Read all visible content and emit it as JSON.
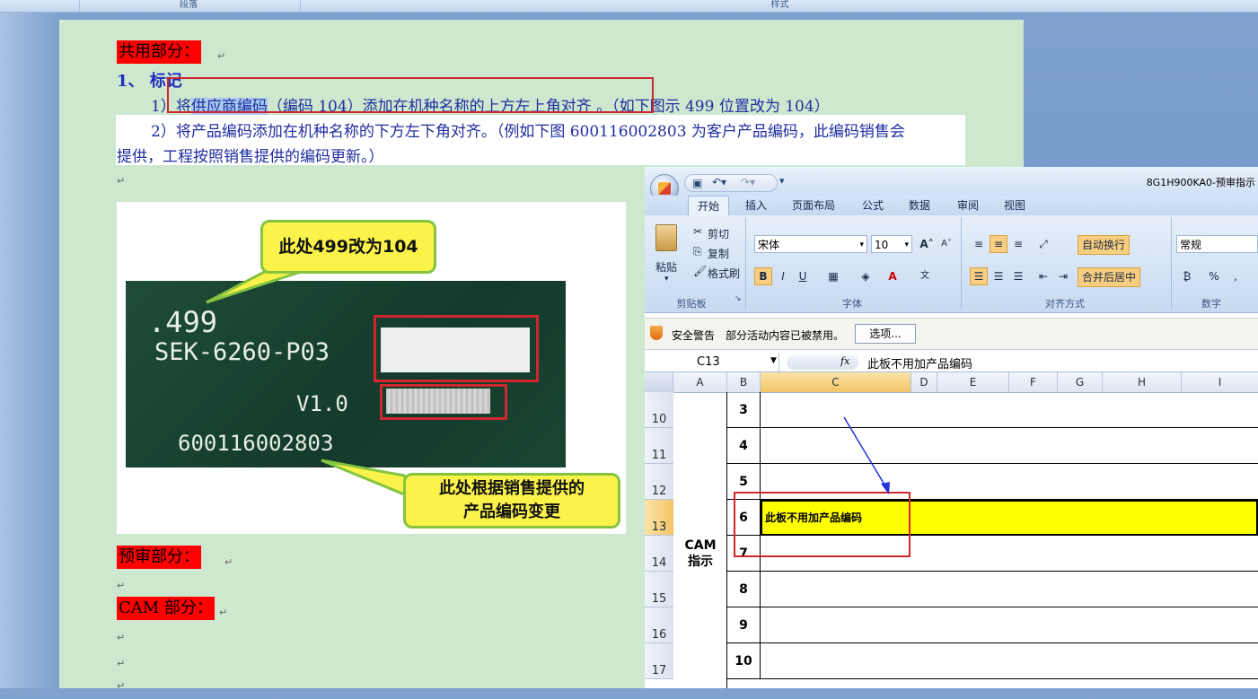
{
  "word": {
    "ribbon_groups": [
      "段落",
      "样式"
    ],
    "shared_heading": "共用部分：",
    "item1": "1、  标记",
    "line1_prefix": "1）",
    "line1_mid": "将",
    "line1_highlight": "供应商编码",
    "line1_rest": "（编码 104）添加在机种名称的上方左上角对齐 。（如下图示 499 位置改为 104）",
    "line2_a": "2）将产品编码添加在机种名称的下方左下角对齐。（例如下图 600116002803 为客户产品编码，此编码销售会",
    "line2_b": "提供，工程按照销售提供的编码更新。）",
    "prereview_heading": "预审部分：",
    "cam_heading": "CAM 部分：",
    "para_mark": "↵"
  },
  "photo": {
    "pcb_line1": ".499",
    "pcb_line2": "SEK-6260-P03",
    "pcb_line3": "V1.0",
    "pcb_line4": "600116002803",
    "callout_top": "此处499改为104",
    "callout_bottom_1": "此处根据销售提供的",
    "callout_bottom_2": "产品编码变更"
  },
  "excel": {
    "title": "8G1H900KA0-预审指示",
    "tabs": [
      "开始",
      "插入",
      "页面布局",
      "公式",
      "数据",
      "审阅",
      "视图"
    ],
    "clipboard": {
      "paste": "粘贴",
      "cut": "剪切",
      "copy": "复制",
      "format_painter": "格式刷",
      "label": "剪贴板"
    },
    "font": {
      "name": "宋体",
      "size": "10",
      "label": "字体"
    },
    "align": {
      "wrap": "自动换行",
      "merge": "合并后居中",
      "label": "对齐方式"
    },
    "number": {
      "format": "常规",
      "label": "数字"
    },
    "security": {
      "title": "安全警告",
      "message": "部分活动内容已被禁用。",
      "options": "选项..."
    },
    "formula": {
      "cell_ref": "C13",
      "fx": "fx",
      "content": "此板不用加产品编码"
    },
    "columns": [
      "A",
      "B",
      "C",
      "D",
      "E",
      "F",
      "G",
      "H",
      "I"
    ],
    "rows": [
      {
        "num": "10",
        "b": "3",
        "c": ""
      },
      {
        "num": "11",
        "b": "4",
        "c": ""
      },
      {
        "num": "12",
        "b": "5",
        "c": ""
      },
      {
        "num": "13",
        "b": "6",
        "c": "此板不用加产品编码"
      },
      {
        "num": "14",
        "b": "7",
        "c": ""
      },
      {
        "num": "15",
        "b": "8",
        "c": ""
      },
      {
        "num": "16",
        "b": "9",
        "c": ""
      },
      {
        "num": "17",
        "b": "10",
        "c": ""
      }
    ],
    "merged_a": "CAM\n指示",
    "colors": {
      "highlight": "#ffff00",
      "annot_red": "#d0262d",
      "arrow": "#2532d8"
    }
  }
}
